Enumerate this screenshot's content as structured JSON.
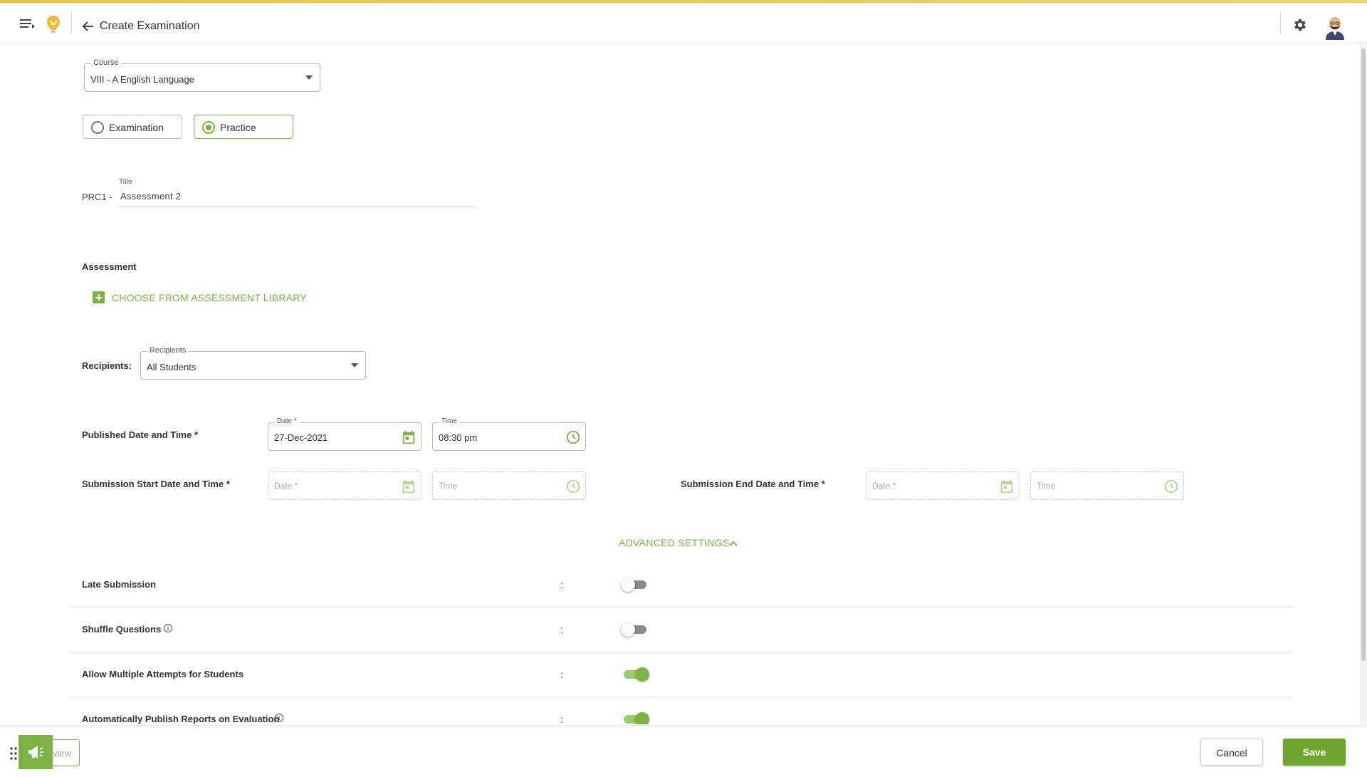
{
  "header": {
    "title": "Create Examination"
  },
  "form": {
    "course": {
      "label": "Course",
      "value": "VIII - A English Language"
    },
    "mode_options": [
      {
        "label": "Examination",
        "selected": false
      },
      {
        "label": "Practice",
        "selected": true
      }
    ],
    "title": {
      "prefix": "PRC1 -",
      "label": "Title",
      "value": "Assessment 2"
    },
    "assessment": {
      "section_label": "Assessment",
      "library_link": "CHOOSE FROM ASSESSMENT LIBRARY"
    },
    "recipients": {
      "section_label": "Recipients:",
      "label": "Recipients",
      "value": "All Students"
    },
    "published": {
      "section_label": "Published Date and Time *",
      "date_label": "Date *",
      "date_value": "27-Dec-2021",
      "time_label": "Time",
      "time_value": "08:30 pm"
    },
    "submission_start": {
      "section_label": "Submission Start Date and Time *",
      "date_placeholder": "Date *",
      "time_placeholder": "Time"
    },
    "submission_end": {
      "section_label": "Submission End Date and Time *",
      "date_placeholder": "Date *",
      "time_placeholder": "Time"
    }
  },
  "advanced": {
    "label": "ADVANCED SETTINGS",
    "colon": ":",
    "settings": [
      {
        "label": "Late Submission",
        "enabled": false,
        "info": false
      },
      {
        "label": "Shuffle Questions",
        "enabled": false,
        "info": true
      },
      {
        "label": "Allow Multiple Attempts for Students",
        "enabled": true,
        "info": false
      },
      {
        "label": "Automatically Publish Reports on Evaluation",
        "enabled": true,
        "info": true
      }
    ]
  },
  "footer": {
    "preview_label": "view",
    "cancel_label": "Cancel",
    "save_label": "Save"
  },
  "colors": {
    "accent": "#7cb342",
    "top_bar": "#f0c040"
  }
}
